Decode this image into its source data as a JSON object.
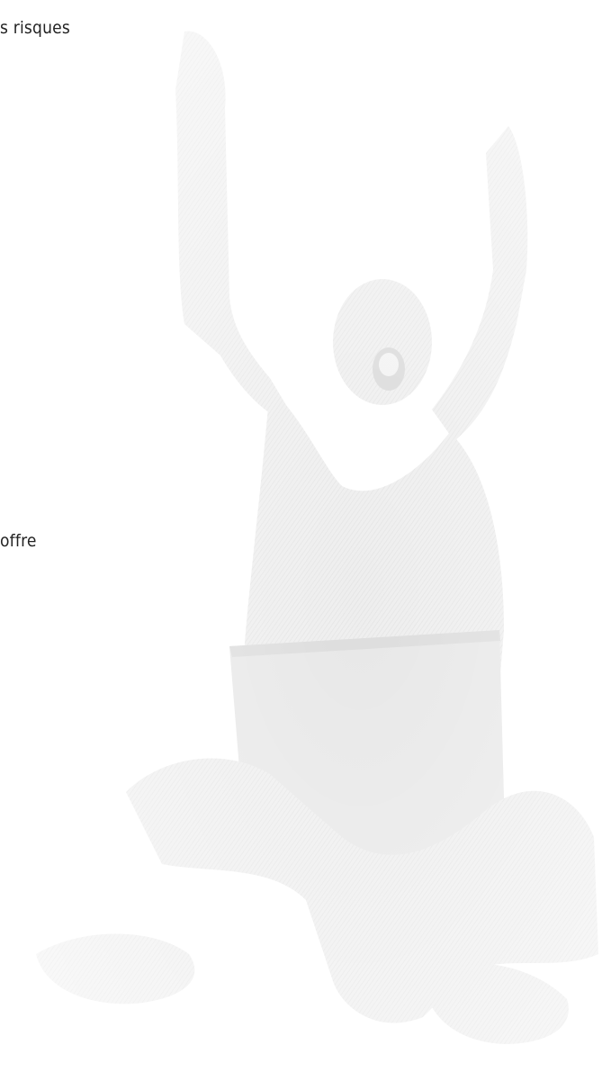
{
  "texts": {
    "line_top": "s risques",
    "line_middle": "offre"
  },
  "background": {
    "icon": "celebrating-person-with-laptop-illustration",
    "tone": "#e6e6e6"
  }
}
